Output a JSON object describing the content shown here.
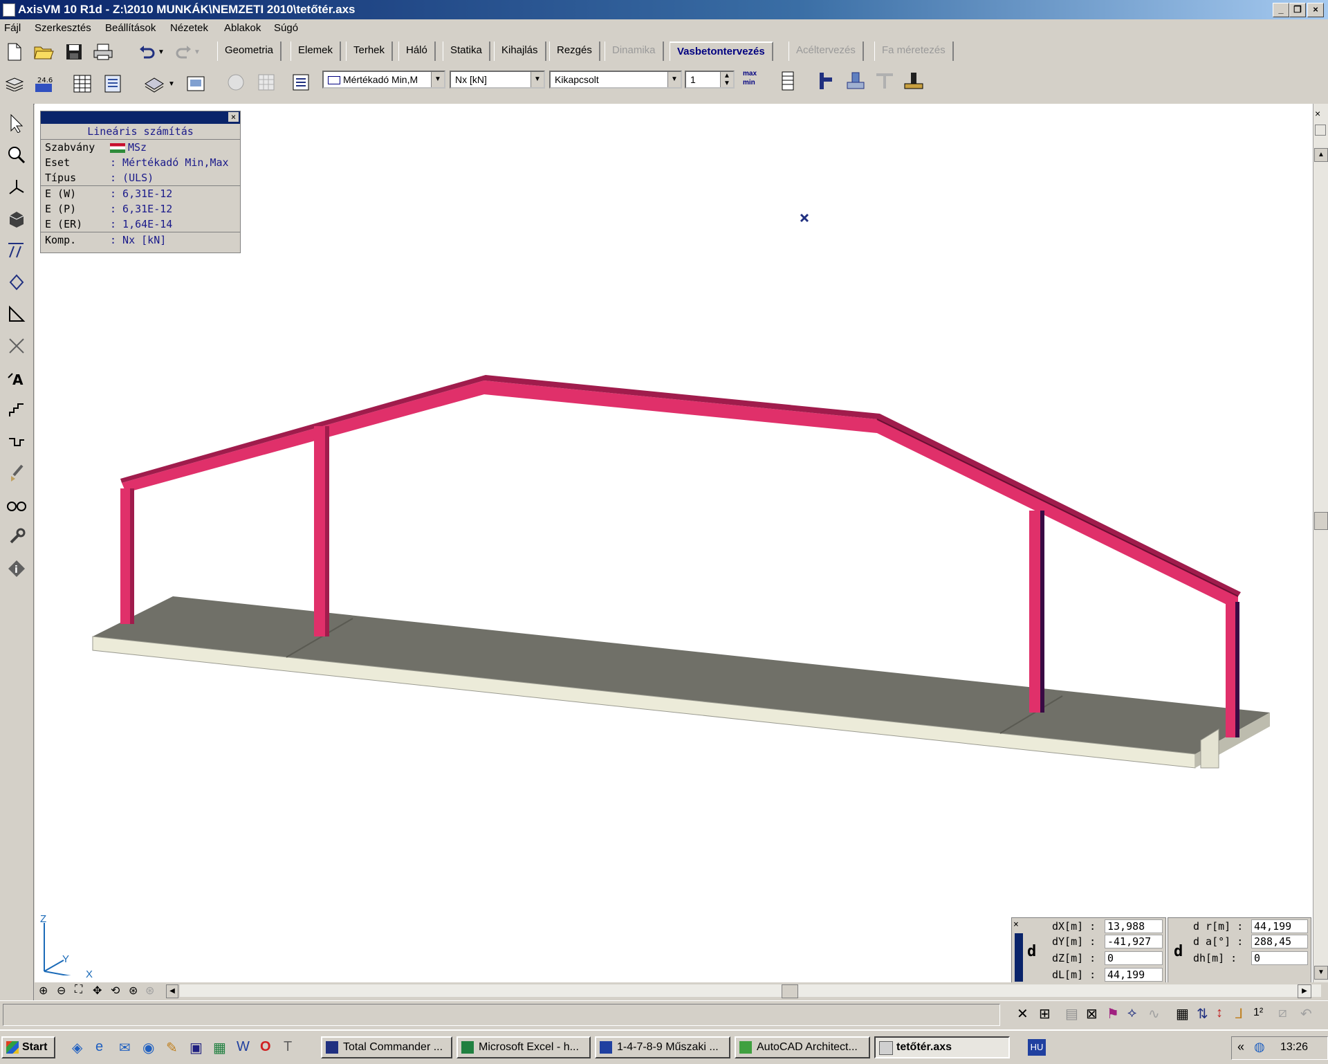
{
  "window": {
    "title": "AxisVM 10 R1d - Z:\\2010 MUNKÁK\\NEMZETI 2010\\tetőtér.axs"
  },
  "menu": [
    "Fájl",
    "Szerkesztés",
    "Beállítások",
    "Nézetek",
    "Ablakok",
    "Súgó"
  ],
  "tabs": [
    {
      "label": "Geometria",
      "state": "normal"
    },
    {
      "label": "Elemek",
      "state": "normal"
    },
    {
      "label": "Terhek",
      "state": "normal"
    },
    {
      "label": "Háló",
      "state": "normal"
    },
    {
      "label": "Statika",
      "state": "normal"
    },
    {
      "label": "Kihajlás",
      "state": "normal"
    },
    {
      "label": "Rezgés",
      "state": "normal"
    },
    {
      "label": "Dinamika",
      "state": "disabled"
    },
    {
      "label": "Vasbetontervezés",
      "state": "active"
    },
    {
      "label": "Acéltervezés",
      "state": "disabled"
    },
    {
      "label": "Fa méretezés",
      "state": "disabled"
    }
  ],
  "toolbar": {
    "case_select": "Mértékadó Min,M",
    "component_select": "Nx [kN]",
    "display_select": "Kikapcsolt",
    "spin_value": "1",
    "minmax_top": "max",
    "minmax_bottom": "min"
  },
  "info_panel": {
    "title": "Lineáris számítás",
    "rows": [
      {
        "key": "Szabvány",
        "value": "MSz"
      },
      {
        "key": "Eset",
        "value": ": Mértékadó Min,Max"
      },
      {
        "key": "Típus",
        "value": ": (ULS)"
      },
      {
        "key": "E (W)",
        "value": ": 6,31E-12"
      },
      {
        "key": "E (P)",
        "value": ": 6,31E-12"
      },
      {
        "key": "E (ER)",
        "value": ": 1,64E-14"
      },
      {
        "key": "Komp.",
        "value": ": Nx [kN]"
      }
    ]
  },
  "axes": {
    "z": "Z",
    "y": "Y",
    "x": "X"
  },
  "coords_left": {
    "d": "d",
    "rows": [
      {
        "label": "dX[m] :",
        "value": "13,988"
      },
      {
        "label": "dY[m] :",
        "value": "-41,927"
      },
      {
        "label": "dZ[m] :",
        "value": "0"
      },
      {
        "label": "dL[m] :",
        "value": "44,199"
      }
    ]
  },
  "coords_right": {
    "d": "d",
    "rows": [
      {
        "label": "d r[m] :",
        "value": "44,199"
      },
      {
        "label": "d  a[°] :",
        "value": "288,45"
      },
      {
        "label": "dh[m] :",
        "value": "0"
      }
    ]
  },
  "status_icons": {
    "superscript": "1²"
  },
  "taskbar": {
    "start": "Start",
    "tasks": [
      {
        "label": "Total Commander ...",
        "active": false
      },
      {
        "label": "Microsoft Excel - h...",
        "active": false
      },
      {
        "label": "1-4-7-8-9 Műszaki ...",
        "active": false
      },
      {
        "label": "AutoCAD Architect...",
        "active": false
      },
      {
        "label": "tetőtér.axs",
        "active": true
      }
    ],
    "lang": "HU",
    "tray_arrow": "«",
    "clock": "13:26"
  },
  "colors": {
    "member": "#e0306a",
    "slab": "#707068",
    "canvas": "#ffffff",
    "titlebar": "#0a246a"
  }
}
